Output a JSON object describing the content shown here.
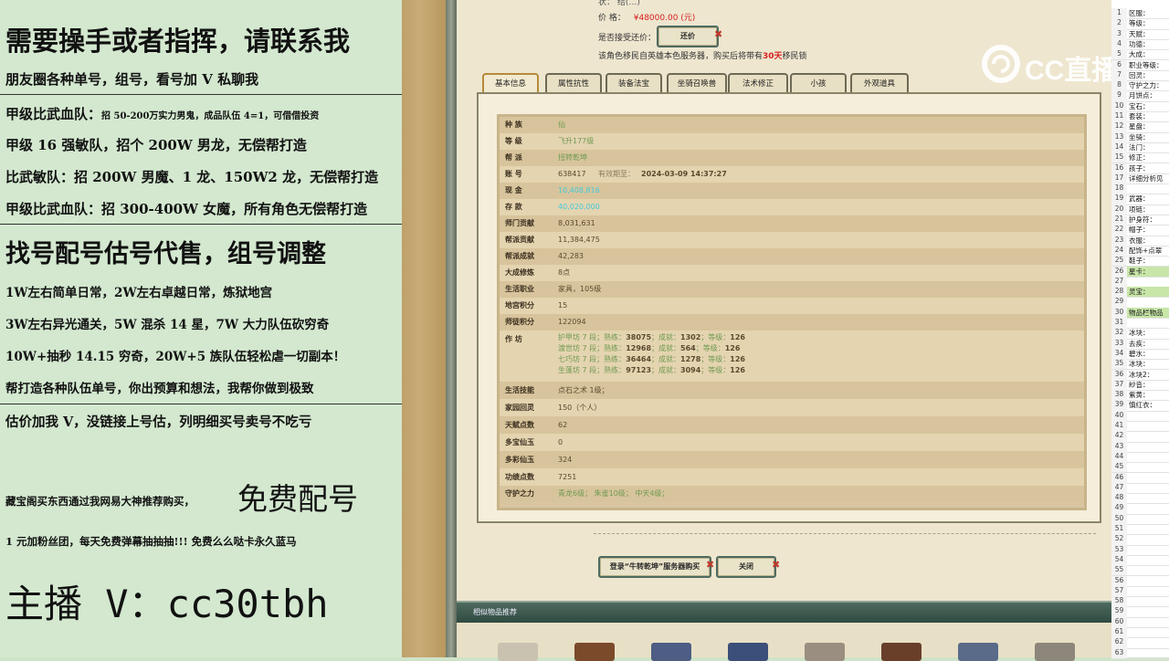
{
  "promo": {
    "lines": [
      "需要操手或者指挥，请联系我",
      "朋友圈各种单号，组号，看号加 V 私聊我",
      "甲级比武血队：",
      "招 50-200万实力男鬼，成品队伍 4=1，可借借投资",
      "甲级 16 强敏队，招个 200W 男龙，无偿帮打造",
      "比武敏队：招 200W 男魔、1 龙、150W2 龙，无偿帮打造",
      "甲级比武血队：招 300-400W 女魔，所有角色无偿帮打造",
      "找号配号估号代售，组号调整",
      "1W左右简单日常，2W左右卓越日常，炼狱地宫",
      "3W左右异光通关，5W 混杀 14 星，7W 大力队伍砍穷奇",
      "10W+抽秒 14.15 穷奇，20W+5 族队伍轻松虐一切副本！",
      "帮打造各种队伍单号，你出预算和想法，我帮你做到极致",
      "估价加我 V，没链接上号估，列明细买号卖号不吃亏",
      "藏宝阁买东西通过我网易大神推荐购买，",
      "免费配号",
      "1 元加粉丝团，每天免费弹幕抽抽抽!!! 免费么么哒卡永久蓝马",
      "主播 V：cc30tbh"
    ]
  },
  "game": {
    "top_text": "状：  结(…)",
    "price_label": "价          格：",
    "price_value": "¥48000.00 (元)",
    "bargain_label": "是否接受还价：",
    "bargain_button": "还价",
    "notice_prefix": "该角色移民自英雄本色服务器，购买后将带有",
    "notice_days": "30天",
    "notice_suffix": "移民锁",
    "tabs": [
      "基本信息",
      "属性抗性",
      "装备法宝",
      "坐骑召唤兽",
      "法术修正",
      "小孩",
      "外观道具"
    ],
    "rows": [
      {
        "label": "种    族",
        "value": "仙",
        "cls": "green"
      },
      {
        "label": "等    级",
        "value": "飞升177级",
        "cls": "green"
      },
      {
        "label": "帮    派",
        "value": "扭转乾坤",
        "cls": "green"
      },
      {
        "label": "账    号",
        "value": "638417",
        "extra1": "有效期至：",
        "extra2": "2024-03-09 14:37:27"
      },
      {
        "label": "现    金",
        "value": "10,408,816",
        "cls": "cyan"
      },
      {
        "label": "存    款",
        "value": "40,020,000",
        "cls": "cyan"
      },
      {
        "label": "师门贡献",
        "value": "8,031,631"
      },
      {
        "label": "帮派贡献",
        "value": "11,384,475"
      },
      {
        "label": "帮派成就",
        "value": "42,283"
      },
      {
        "label": "大成修炼",
        "value": "8点"
      },
      {
        "label": "生活职业",
        "value": "家具，105级"
      },
      {
        "label": "地宫积分",
        "value": "15"
      },
      {
        "label": "师徒积分",
        "value": "122094"
      }
    ],
    "workshop_label": "作    坊",
    "workshop": [
      [
        "护甲坊 7 段；熟练：",
        "38075",
        "；成就：",
        "1302",
        "；等级：",
        "126"
      ],
      [
        "渡世坊 7 段；熟练：",
        "12968",
        "；成就：",
        "564",
        "；等级：",
        "126"
      ],
      [
        "七巧坊 7 段；熟练：",
        "36464",
        "；成就：",
        "1278",
        "；等级：",
        "126"
      ],
      [
        "生蓬坊 7 段；熟练：",
        "97123",
        "；成就：",
        "3094",
        "；等级：",
        "126"
      ]
    ],
    "rows2": [
      {
        "label": "生活技能",
        "value": "点石之术 1级；"
      },
      {
        "label": "家园回灵",
        "value": "150（个人）"
      },
      {
        "label": "天赋点数",
        "value": "62"
      },
      {
        "label": "多宝仙玉",
        "value": "0"
      },
      {
        "label": "多彩仙玉",
        "value": "324"
      },
      {
        "label": "功绩点数",
        "value": "7251"
      },
      {
        "label": "守护之力",
        "value": "青龙6级；  朱雀10级；  中天4级；",
        "cls": "green"
      }
    ],
    "buy_button": "登录“牛转乾坤”服务器购买",
    "close_button": "关闭",
    "similar_title": "相似物品推荐"
  },
  "sheet": {
    "rows": [
      {
        "n": "1",
        "t": "区服："
      },
      {
        "n": "2",
        "t": "等级："
      },
      {
        "n": "3",
        "t": "天赋："
      },
      {
        "n": "4",
        "t": "功德："
      },
      {
        "n": "5",
        "t": "大成："
      },
      {
        "n": "6",
        "t": "职业等级："
      },
      {
        "n": "7",
        "t": "回灵："
      },
      {
        "n": "8",
        "t": "守护之力："
      },
      {
        "n": "9",
        "t": "月饼点："
      },
      {
        "n": "10",
        "t": "宝石："
      },
      {
        "n": "11",
        "t": "套装："
      },
      {
        "n": "12",
        "t": "星盘："
      },
      {
        "n": "13",
        "t": "坐骑："
      },
      {
        "n": "14",
        "t": "法门："
      },
      {
        "n": "15",
        "t": "修正："
      },
      {
        "n": "16",
        "t": "孩子："
      },
      {
        "n": "17",
        "t": "详细分析见"
      },
      {
        "n": "18",
        "t": ""
      },
      {
        "n": "19",
        "t": "武器："
      },
      {
        "n": "20",
        "t": "项链："
      },
      {
        "n": "21",
        "t": "护身符："
      },
      {
        "n": "22",
        "t": "帽子："
      },
      {
        "n": "23",
        "t": "衣服："
      },
      {
        "n": "24",
        "t": "配饰+点翠"
      },
      {
        "n": "25",
        "t": "鞋子："
      },
      {
        "n": "26",
        "t": "星卡：",
        "hl": true
      },
      {
        "n": "27",
        "t": ""
      },
      {
        "n": "28",
        "t": "灵宝：",
        "hl": true
      },
      {
        "n": "29",
        "t": ""
      },
      {
        "n": "30",
        "t": "物品栏物品",
        "hl": true
      },
      {
        "n": "31",
        "t": ""
      },
      {
        "n": "32",
        "t": "冰块："
      },
      {
        "n": "33",
        "t": "去疾："
      },
      {
        "n": "34",
        "t": "碧水："
      },
      {
        "n": "35",
        "t": "冰块："
      },
      {
        "n": "36",
        "t": "冰块2："
      },
      {
        "n": "37",
        "t": "紗音："
      },
      {
        "n": "38",
        "t": "紫黄："
      },
      {
        "n": "39",
        "t": "慎红衣："
      },
      {
        "n": "40",
        "t": ""
      },
      {
        "n": "41",
        "t": ""
      },
      {
        "n": "42",
        "t": ""
      },
      {
        "n": "43",
        "t": ""
      },
      {
        "n": "44",
        "t": ""
      },
      {
        "n": "45",
        "t": ""
      },
      {
        "n": "46",
        "t": ""
      },
      {
        "n": "47",
        "t": ""
      },
      {
        "n": "48",
        "t": ""
      },
      {
        "n": "49",
        "t": ""
      },
      {
        "n": "50",
        "t": ""
      },
      {
        "n": "51",
        "t": ""
      },
      {
        "n": "52",
        "t": ""
      },
      {
        "n": "53",
        "t": ""
      },
      {
        "n": "54",
        "t": ""
      },
      {
        "n": "55",
        "t": ""
      },
      {
        "n": "56",
        "t": ""
      },
      {
        "n": "57",
        "t": ""
      },
      {
        "n": "58",
        "t": ""
      },
      {
        "n": "59",
        "t": ""
      },
      {
        "n": "60",
        "t": ""
      },
      {
        "n": "61",
        "t": ""
      },
      {
        "n": "62",
        "t": ""
      },
      {
        "n": "63",
        "t": ""
      }
    ]
  },
  "watermark": "CC直播",
  "colors": {
    "promo_bg": "#d3e8cf",
    "price_red": "#d62020",
    "table_bg": "#d9c59f",
    "sheet_highlight": "#c8e6a8"
  }
}
